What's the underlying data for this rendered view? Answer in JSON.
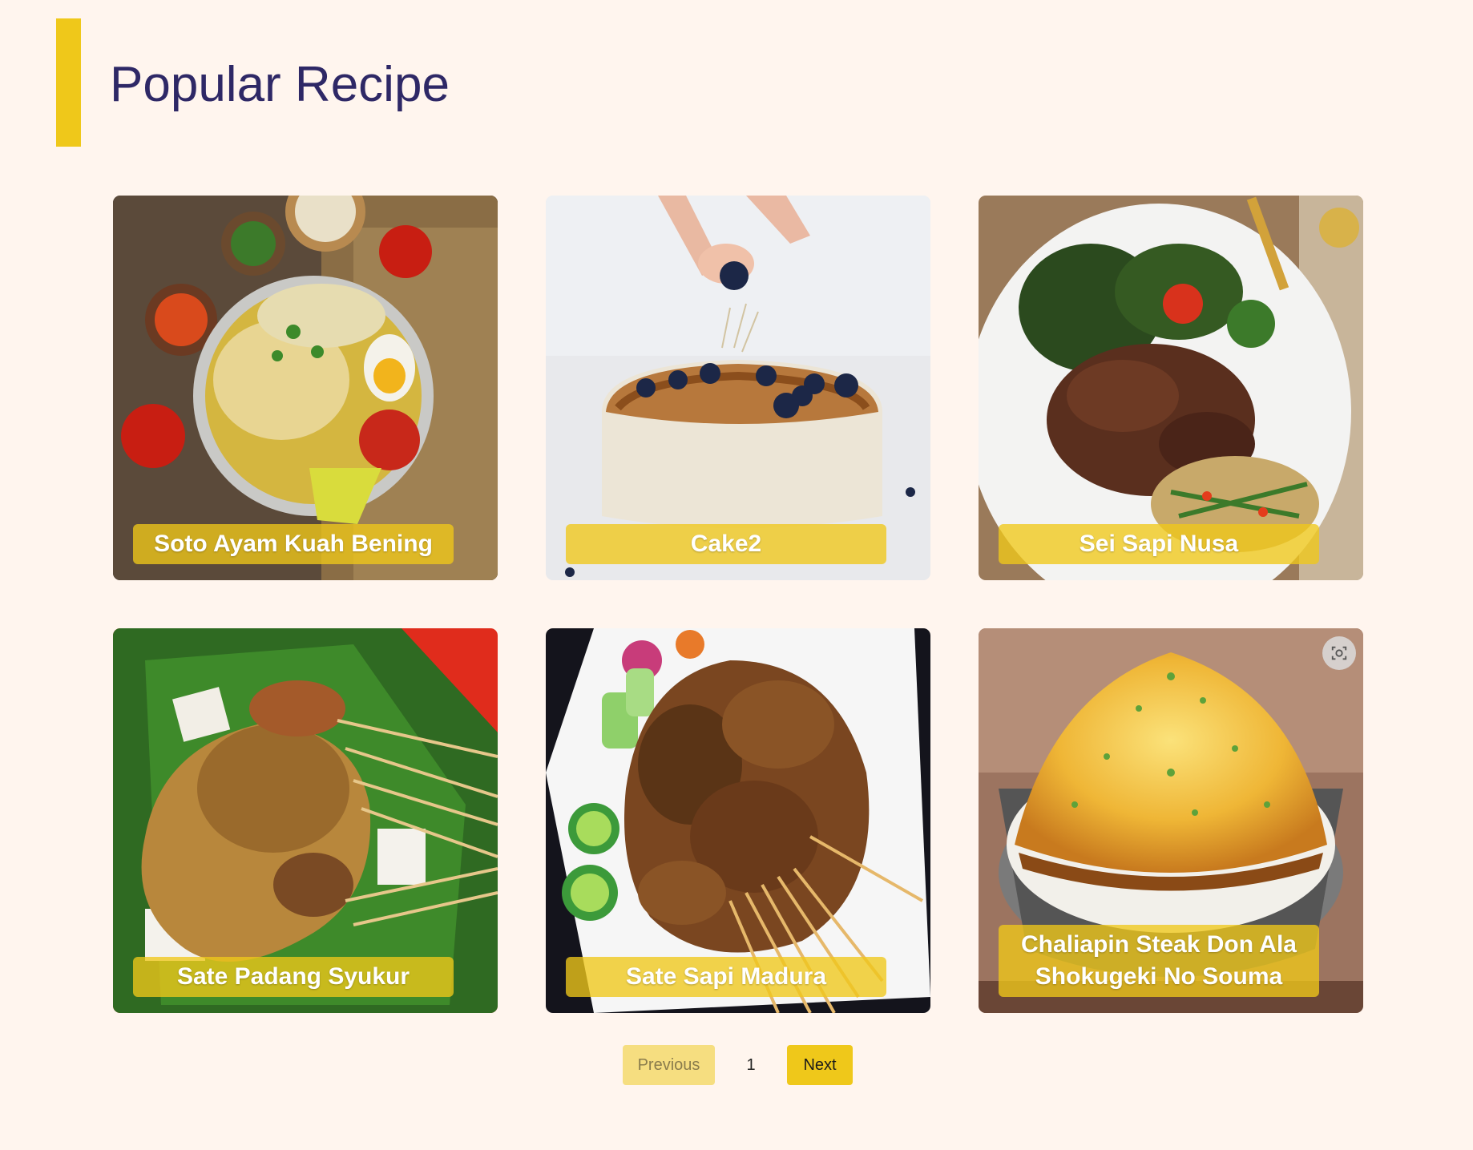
{
  "page": {
    "title": "Popular Recipe",
    "accent_color": "#EFC81A",
    "title_color": "#2E2866",
    "background": "#FFF5EE"
  },
  "recipes": [
    {
      "name": "Soto Ayam Kuah Bening",
      "image": "soto-ayam-bowl"
    },
    {
      "name": "Cake2",
      "image": "blueberry-cake"
    },
    {
      "name": "Sei Sapi Nusa",
      "image": "sei-sapi-plate"
    },
    {
      "name": "Sate Padang Syukur",
      "image": "sate-padang"
    },
    {
      "name": "Sate Sapi Madura",
      "image": "sate-sapi"
    },
    {
      "name": "Chaliapin Steak Don Ala Shokugeki No Souma",
      "image": "chaliapin-steak-don",
      "overlay_icon": "scan-icon"
    }
  ],
  "pagination": {
    "previous_label": "Previous",
    "current_page": "1",
    "next_label": "Next"
  }
}
